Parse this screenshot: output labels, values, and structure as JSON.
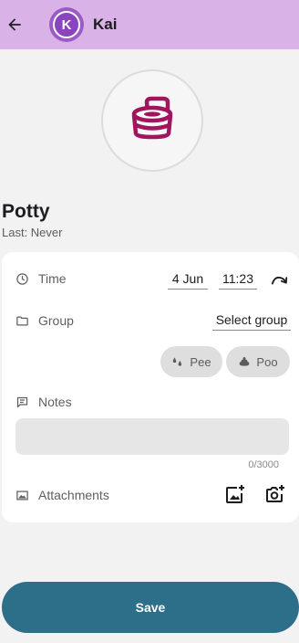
{
  "appbar": {
    "name": "Kai",
    "avatar_initial": "K",
    "back_icon": "arrow-back-icon"
  },
  "hero": {
    "icon": "potty-icon",
    "color": "#a0155d"
  },
  "header": {
    "title": "Potty",
    "subtitle": "Last: Never"
  },
  "form": {
    "time_label": "Time",
    "date_value": "4 Jun",
    "time_value": "11:23",
    "group_label": "Group",
    "group_value": "Select group",
    "chips": [
      {
        "label": "Pee",
        "icon": "droplets-icon"
      },
      {
        "label": "Poo",
        "icon": "poo-icon"
      }
    ],
    "notes_label": "Notes",
    "notes_value": "",
    "notes_counter": "0/3000",
    "attachments_label": "Attachments"
  },
  "save_label": "Save",
  "colors": {
    "appbar": "#d9b3e8",
    "accent": "#2d6e89",
    "avatar": "#8a44be"
  }
}
